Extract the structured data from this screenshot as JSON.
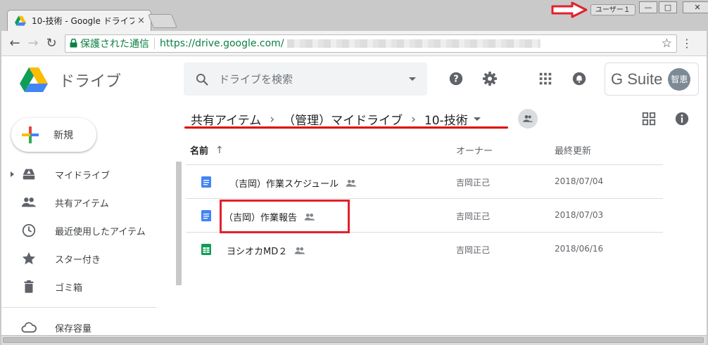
{
  "browser": {
    "tab_title": "10-技術 - Google ドライブ",
    "tab_close": "×",
    "user_badge": "ユーザー１",
    "window_controls": {
      "minimize": "—",
      "maximize": "□",
      "close": "✕"
    },
    "nav": {
      "back": "←",
      "forward": "→",
      "reload": "↻"
    },
    "secure_label": "保護された通信",
    "url": "https://drive.google.com/",
    "star": "☆",
    "menu": "⋮",
    "colors": {
      "secure_green": "#0b8043",
      "annotation_red": "#e3202b"
    }
  },
  "header": {
    "app_name": "ドライブ",
    "search_placeholder": "ドライブを検索",
    "gsuite_label": "G Suite",
    "avatar_text": "智恵",
    "icons": [
      "help-icon",
      "settings-icon",
      "apps-grid-icon",
      "notifications-icon"
    ]
  },
  "breadcrumb": {
    "items": [
      "共有アイテム",
      "（管理）マイドライブ",
      "10-技術"
    ],
    "separator": "›"
  },
  "sidebar": {
    "new_label": "新規",
    "items": [
      {
        "label": "マイドライブ",
        "icon": "my-drive-icon"
      },
      {
        "label": "共有アイテム",
        "icon": "people-icon"
      },
      {
        "label": "最近使用したアイテム",
        "icon": "clock-icon"
      },
      {
        "label": "スター付き",
        "icon": "star-icon"
      },
      {
        "label": "ゴミ箱",
        "icon": "trash-icon"
      },
      {
        "label": "保存容量",
        "icon": "cloud-icon"
      }
    ]
  },
  "file_list": {
    "columns": {
      "name": "名前",
      "owner": "オーナー",
      "modified": "最終更新"
    },
    "sort_arrow": "↑",
    "rows": [
      {
        "name": "（吉岡）作業スケジュール",
        "owner": "吉岡正己",
        "modified": "2018/07/04",
        "type": "doc"
      },
      {
        "name": "（吉岡）作業報告",
        "owner": "吉岡正己",
        "modified": "2018/07/03",
        "type": "doc"
      },
      {
        "name": "ヨシオカMD２",
        "owner": "吉岡正己",
        "modified": "2018/06/16",
        "type": "sheet"
      }
    ]
  }
}
